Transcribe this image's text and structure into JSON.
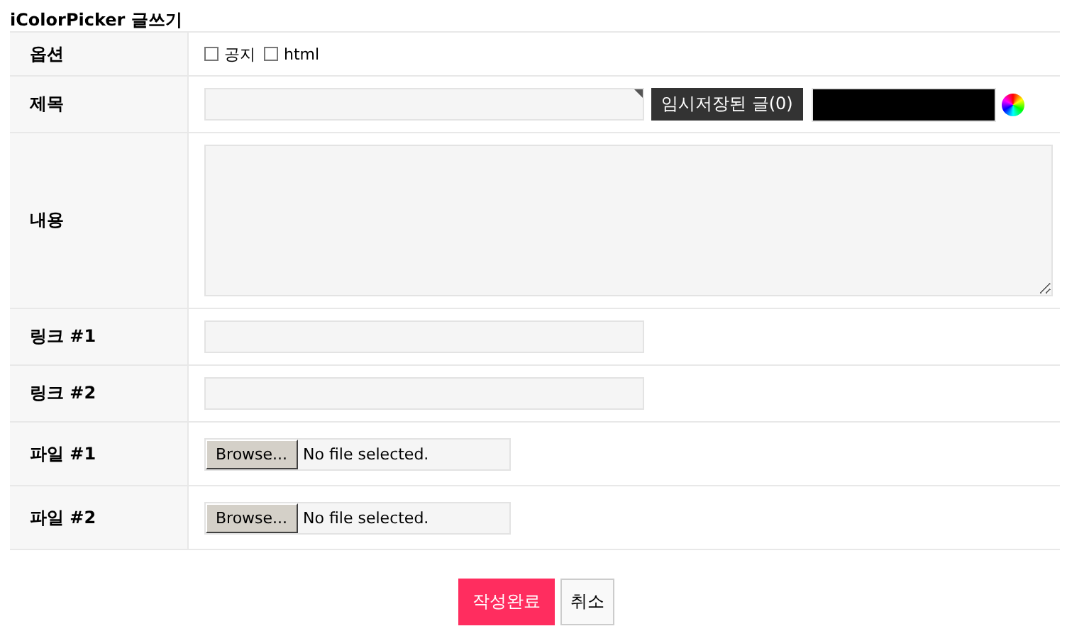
{
  "title": "iColorPicker 글쓰기",
  "rows": [
    {
      "label": "옵션",
      "kind": "options",
      "options": [
        {
          "label": "공지",
          "checked": false
        },
        {
          "label": "html",
          "checked": false
        }
      ]
    },
    {
      "label": "제목",
      "kind": "subject",
      "button": "임시저장된 글(0)"
    },
    {
      "label": "내용",
      "kind": "textarea"
    },
    {
      "label": "링크 #1",
      "kind": "text"
    },
    {
      "label": "링크 #2",
      "kind": "text"
    },
    {
      "label": "파일 #1",
      "kind": "file",
      "button": "Browse...",
      "status": "No file selected."
    },
    {
      "label": "파일 #2",
      "kind": "file",
      "button": "Browse...",
      "status": "No file selected."
    }
  ],
  "buttons": [
    {
      "label": "작성완료",
      "kind": "primary"
    },
    {
      "label": "취소",
      "kind": "secondary"
    }
  ]
}
